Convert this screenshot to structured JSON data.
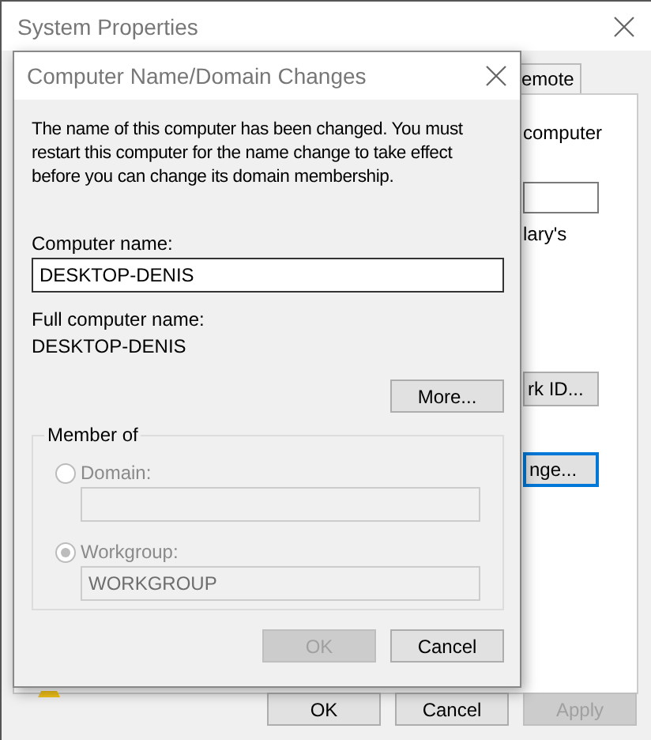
{
  "back_window": {
    "title": "System Properties",
    "tabs": [
      {
        "label": "emote",
        "selected": false
      }
    ],
    "texts": [
      "computer",
      "lary's"
    ],
    "buttons": [
      {
        "label": "rk ID...",
        "focused": false
      },
      {
        "label": "nge...",
        "focused": true
      }
    ],
    "footer_buttons": [
      {
        "label": "OK",
        "disabled": false
      },
      {
        "label": "Cancel",
        "disabled": false
      },
      {
        "label": "Apply",
        "disabled": true
      }
    ]
  },
  "dialog": {
    "title": "Computer Name/Domain Changes",
    "message": "The name of this computer has been changed.  You must restart this computer for the name change to take effect before you can change its domain membership.",
    "computer_name_label": "Computer name:",
    "computer_name": "DESKTOP-DENIS",
    "full_name_label": "Full computer name:",
    "full_name": "DESKTOP-DENIS",
    "more_button": "More...",
    "member_of": {
      "title": "Member of",
      "disabled": true,
      "options": [
        {
          "label": "Domain:",
          "selected": false
        },
        {
          "label": "Workgroup:",
          "selected": true,
          "value": "WORKGROUP"
        }
      ]
    },
    "buttons": [
      {
        "label": "OK",
        "disabled": true
      },
      {
        "label": "Cancel",
        "disabled": false
      }
    ]
  }
}
